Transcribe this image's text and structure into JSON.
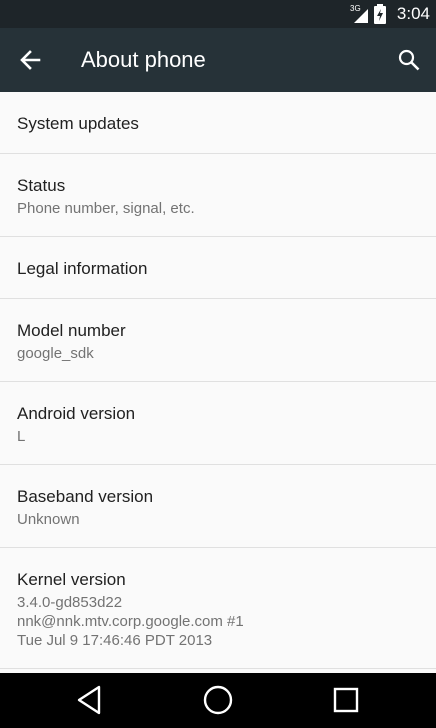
{
  "status_bar": {
    "network_label": "3G",
    "time": "3:04"
  },
  "app_bar": {
    "title": "About phone",
    "back_icon": "arrow-back-icon",
    "search_icon": "search-icon"
  },
  "items": [
    {
      "title": "System updates"
    },
    {
      "title": "Status",
      "summary": "Phone number, signal, etc."
    },
    {
      "title": "Legal information"
    },
    {
      "title": "Model number",
      "summary": "google_sdk"
    },
    {
      "title": "Android version",
      "summary": "L"
    },
    {
      "title": "Baseband version",
      "summary": "Unknown"
    },
    {
      "title": "Kernel version",
      "summary_lines": [
        "3.4.0-gd853d22",
        "nnk@nnk.mtv.corp.google.com #1",
        "Tue Jul 9 17:46:46 PDT 2013"
      ]
    }
  ],
  "nav_bar": {
    "back": "nav-back-icon",
    "home": "nav-home-icon",
    "recents": "nav-recents-icon"
  },
  "colors": {
    "status_bar": "#1e2529",
    "app_bar": "#263238",
    "background": "#fafafa",
    "divider": "#e0e0e0",
    "primary_text": "#212121",
    "secondary_text": "#737373"
  }
}
